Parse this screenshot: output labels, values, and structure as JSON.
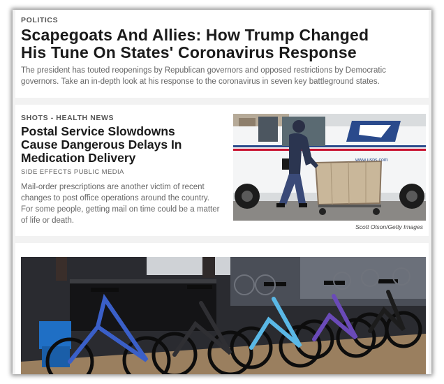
{
  "story1": {
    "slug": "POLITICS",
    "headline_line1": "Scapegoats And Allies: How Trump Changed",
    "headline_line2": "His Tune On States' Coronavirus Response",
    "teaser": "The president has touted reopenings by Republican governors and opposed restrictions by Democratic governors. Take an in-depth look at his response to the coronavirus in seven key battleground states."
  },
  "story2": {
    "slug": "SHOTS - HEALTH NEWS",
    "headline_line1": "Postal Service Slowdowns",
    "headline_line2": "Cause Dangerous Delays In",
    "headline_line3": "Medication Delivery",
    "source": "SIDE EFFECTS PUBLIC MEDIA",
    "teaser": "Mail-order prescriptions are another victim of recent changes to post office operations around the country. For some people, getting mail on time could be a matter of life or death.",
    "photo_credit": "Scott Olson/Getty Images",
    "photo_truck_text": "www.usps.com"
  },
  "story3": {
    "photo_subject": "bicycle-shop-photo"
  },
  "colors": {
    "headline": "#1a1a1a",
    "slug": "#555555",
    "teaser": "#666666",
    "usps_blue": "#2a4a8c",
    "usps_red": "#c8102e"
  }
}
